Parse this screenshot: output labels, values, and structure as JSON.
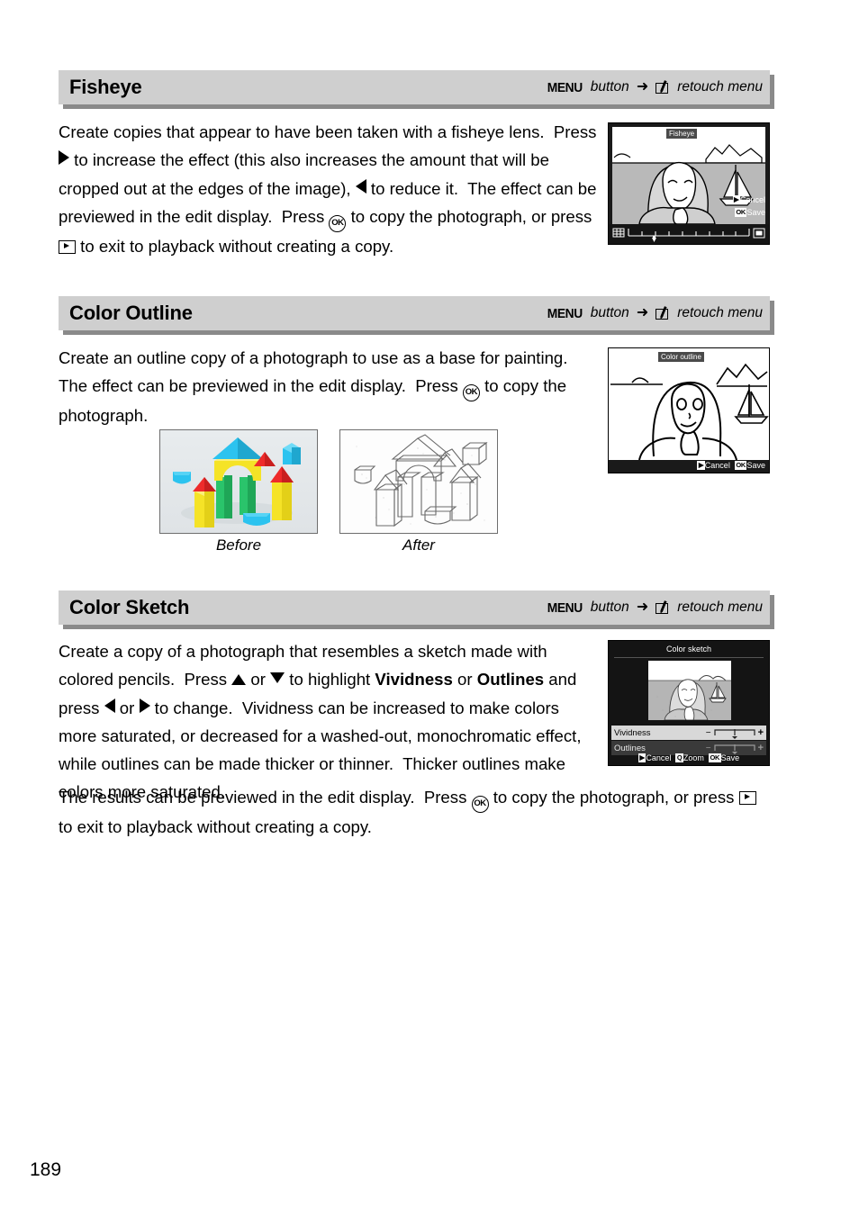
{
  "page": {
    "number": "189"
  },
  "header_common": {
    "menu_word": "MENU",
    "button_word": "button",
    "arrow": "➜",
    "retouch_label": "retouch menu",
    "retouch_icon": "retouch-pen-icon",
    "bar_color": "#cfcfcf",
    "shadow_color": "#8a8a8a"
  },
  "sections": [
    {
      "id": "fisheye",
      "title": "Fisheye",
      "body_runs": [
        {
          "t": "text",
          "v": "Create copies that appear to have been taken with a fisheye lens.  Press "
        },
        {
          "t": "glyph",
          "v": "triangle-right"
        },
        {
          "t": "text",
          "v": " to increase the effect (this also increases the amount that will be cropped out at the edges of the image), "
        },
        {
          "t": "glyph",
          "v": "triangle-left"
        },
        {
          "t": "text",
          "v": " to reduce it.  The effect can be previewed in the edit display.  Press "
        },
        {
          "t": "glyph",
          "v": "ok-button"
        },
        {
          "t": "text",
          "v": " to copy the photograph, or press "
        },
        {
          "t": "glyph",
          "v": "playback-button"
        },
        {
          "t": "text",
          "v": " to exit to playback without creating a copy."
        }
      ],
      "screen": {
        "title_badge": "Fisheye",
        "buttons": [
          {
            "chip": "▶",
            "label": "Cancel"
          },
          {
            "chip": "OK",
            "label": "Save"
          }
        ],
        "has_slider": true,
        "style": "photo"
      }
    },
    {
      "id": "color-outline",
      "title": "Color Outline",
      "body_runs": [
        {
          "t": "text",
          "v": "Create an outline copy of a photograph to use as a base for painting.  The effect can be previewed in the edit display.  Press "
        },
        {
          "t": "glyph",
          "v": "ok-button"
        },
        {
          "t": "text",
          "v": " to copy the photograph."
        }
      ],
      "screen": {
        "title_badge": "Color outline",
        "buttons": [
          {
            "chip": "▶",
            "label": "Cancel"
          },
          {
            "chip": "OK",
            "label": "Save"
          }
        ],
        "has_slider": false,
        "style": "outline"
      },
      "comparison": {
        "before_caption": "Before",
        "after_caption": "After",
        "before_alt": "colored-building-blocks-photo",
        "after_alt": "pencil-outline-sketch-of-blocks",
        "colors": {
          "cyan": "#2cc3ef",
          "yellow": "#f5e327",
          "green": "#2ac46b",
          "red": "#ee2b2b",
          "background": "#e2e6e9"
        }
      }
    },
    {
      "id": "color-sketch",
      "title": "Color Sketch",
      "body_runs": [
        {
          "t": "text",
          "v": "Create a copy of a photograph that resembles a sketch made with colored pencils.  Press "
        },
        {
          "t": "glyph",
          "v": "triangle-up"
        },
        {
          "t": "text",
          "v": " or "
        },
        {
          "t": "glyph",
          "v": "triangle-down"
        },
        {
          "t": "text",
          "v": " to highlight "
        },
        {
          "t": "bold",
          "v": "Vividness"
        },
        {
          "t": "text",
          "v": " or "
        },
        {
          "t": "bold",
          "v": "Outlines"
        },
        {
          "t": "text",
          "v": " and press "
        },
        {
          "t": "glyph",
          "v": "triangle-left"
        },
        {
          "t": "text",
          "v": " or "
        },
        {
          "t": "glyph",
          "v": "triangle-right"
        },
        {
          "t": "text",
          "v": " to change.  Vividness can be increased to make colors more saturated, or decreased for a washed-out, monochromatic effect, while outlines can be made thicker or thinner.  Thicker outlines make colors more saturated.  The results can be previewed in the edit display.  Press "
        },
        {
          "t": "glyph",
          "v": "ok-button"
        },
        {
          "t": "text",
          "v": " to copy the photograph, or press "
        },
        {
          "t": "glyph",
          "v": "playback-button"
        },
        {
          "t": "text",
          "v": " to exit to playback without creating a copy."
        }
      ],
      "screen": {
        "title_badge": "Color sketch",
        "options": [
          {
            "label": "Vividness",
            "selected": true,
            "minus": "−",
            "plus": "+"
          },
          {
            "label": "Outlines",
            "selected": false,
            "minus": "−",
            "plus": "+"
          }
        ],
        "buttons": [
          {
            "chip": "▶",
            "label": "Cancel"
          },
          {
            "chip": "Q",
            "label": "Zoom"
          },
          {
            "chip": "OK",
            "label": "Save"
          }
        ],
        "has_slider": false,
        "style": "sketch"
      }
    }
  ]
}
